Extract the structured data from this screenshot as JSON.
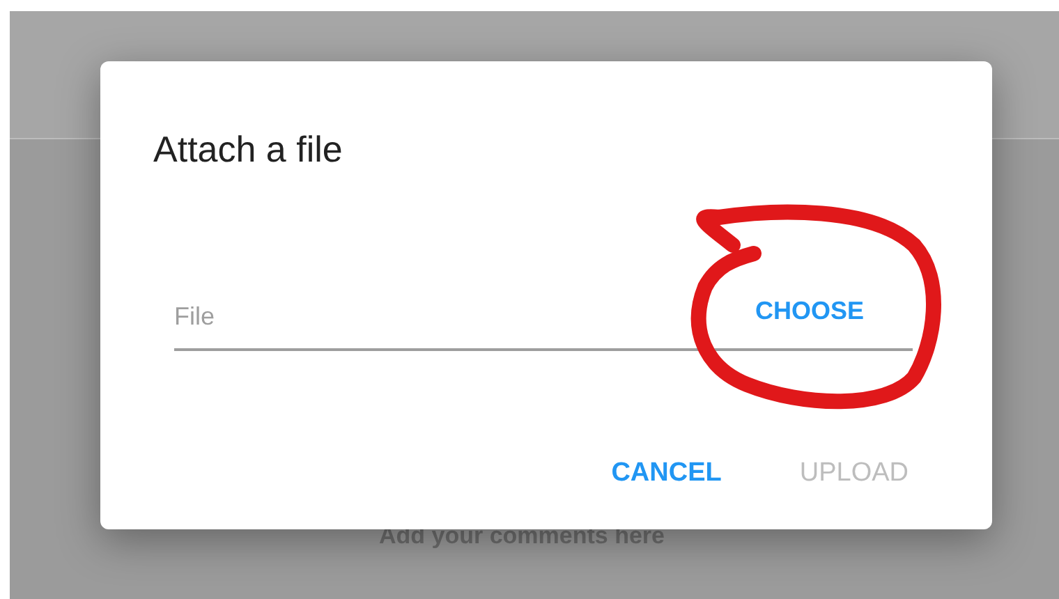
{
  "page": {
    "comments_hint": "Add your comments here"
  },
  "dialog": {
    "title": "Attach a file",
    "field": {
      "placeholder": "File"
    },
    "choose_button": {
      "label": "CHOOSE"
    },
    "buttons": [
      {
        "label": "CANCEL",
        "disabled": false
      },
      {
        "label": "UPLOAD",
        "disabled": true
      }
    ]
  },
  "annotation": {
    "kind": "circle"
  }
}
